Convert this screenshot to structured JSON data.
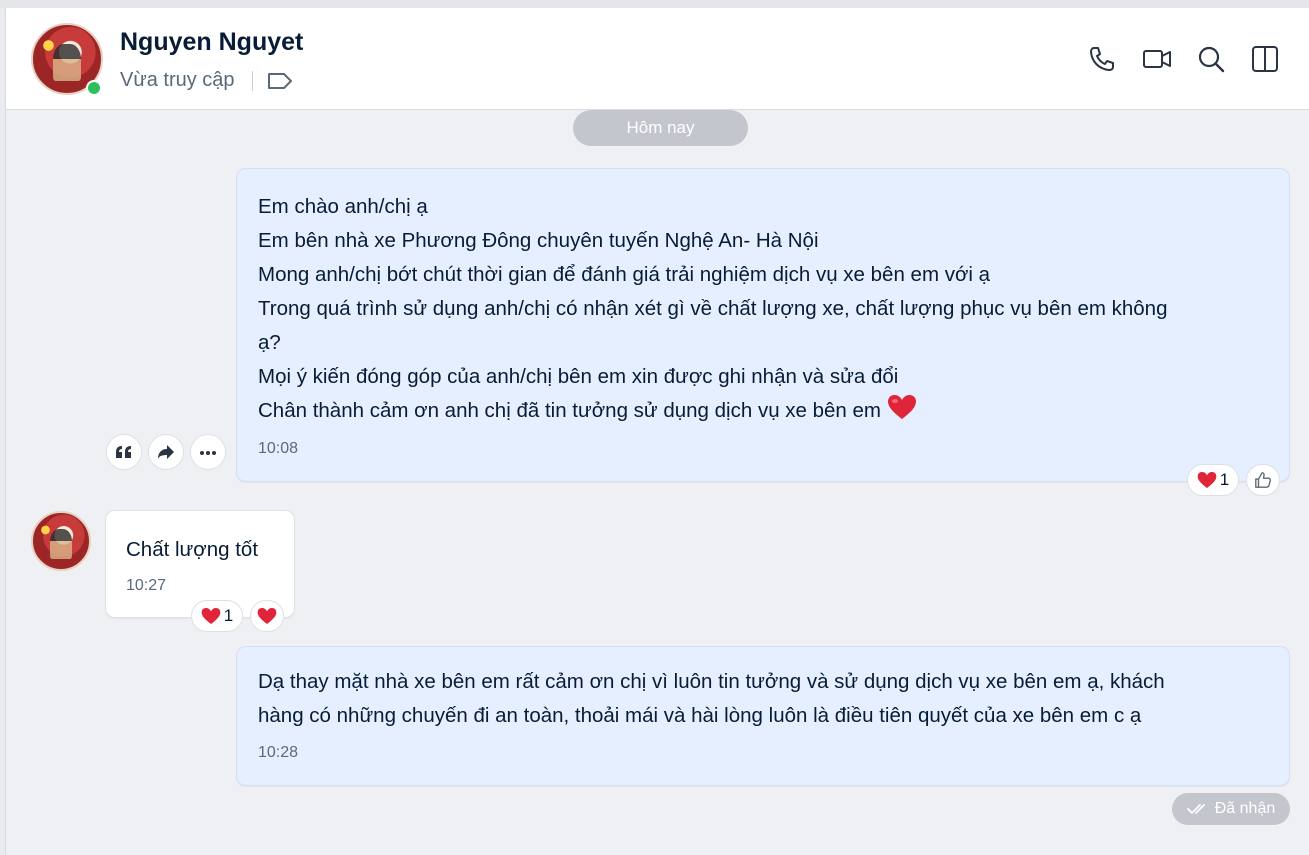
{
  "header": {
    "contact_name": "Nguyen Nguyet",
    "status": "Vừa truy cập",
    "icons": [
      "phone-icon",
      "video-call-icon",
      "search-icon",
      "sidebar-toggle-icon",
      "tag-icon"
    ]
  },
  "conversation": {
    "date_divider": "Hôm nay",
    "messages": [
      {
        "direction": "outgoing",
        "lines": [
          "Em chào anh/chị ạ",
          "Em bên nhà xe Phương Đông chuyên tuyến Nghệ An- Hà Nội",
          "Mong anh/chị bớt chút thời gian để đánh giá trải nghiệm dịch vụ xe bên em với ạ",
          "Trong quá trình sử dụng anh/chị có nhận xét gì về chất lượng xe, chất lượng phục vụ bên em không",
          "ạ?",
          "Mọi ý kiến đóng góp của anh/chị bên em xin được ghi nhận và sửa đổi",
          "Chân thành cảm ơn anh chị đã tin tưởng sử dụng dịch vụ xe bên em"
        ],
        "time": "10:08",
        "reaction_count": "1"
      },
      {
        "direction": "incoming",
        "text": "Chất lượng tốt",
        "time": "10:27",
        "reaction_count": "1"
      },
      {
        "direction": "outgoing",
        "lines": [
          "Dạ thay mặt nhà xe bên em rất cảm ơn chị vì luôn tin tưởng và sử dụng dịch vụ xe bên em ạ, khách",
          "hàng có những chuyến đi an toàn, thoải mái và hài lòng luôn là điều tiên quyết của xe bên em c ạ"
        ],
        "time": "10:28",
        "status": "Đã nhận"
      }
    ]
  },
  "colors": {
    "outgoing_bubble": "#e5efff",
    "incoming_bubble": "#ffffff",
    "online": "#2dbf5d",
    "heart": "#e0243a",
    "pill": "#c3c6cc"
  }
}
